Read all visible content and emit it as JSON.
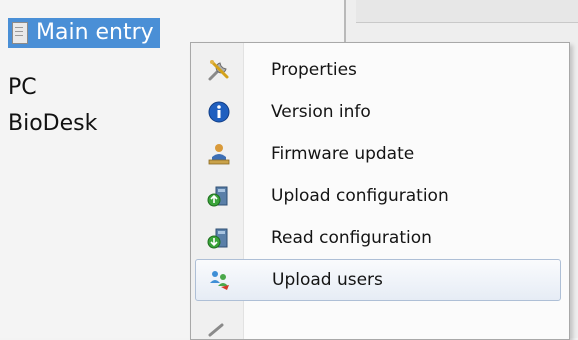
{
  "tree": {
    "items": [
      {
        "label": "Main entry",
        "selected": true
      },
      {
        "label": "PC",
        "selected": false
      },
      {
        "label": "BioDesk",
        "selected": false
      }
    ]
  },
  "context_menu": {
    "items": [
      {
        "label": "Properties",
        "icon": "properties-icon"
      },
      {
        "label": "Version info",
        "icon": "info-icon"
      },
      {
        "label": "Firmware update",
        "icon": "firmware-icon"
      },
      {
        "label": "Upload configuration",
        "icon": "upload-config-icon"
      },
      {
        "label": "Read configuration",
        "icon": "read-config-icon"
      },
      {
        "label": "Upload users",
        "icon": "upload-users-icon",
        "highlighted": true
      }
    ]
  },
  "colors": {
    "selection": "#4a8fd6",
    "menu_hover_border": "#aebfd6",
    "info_blue": "#1f5fbf"
  }
}
